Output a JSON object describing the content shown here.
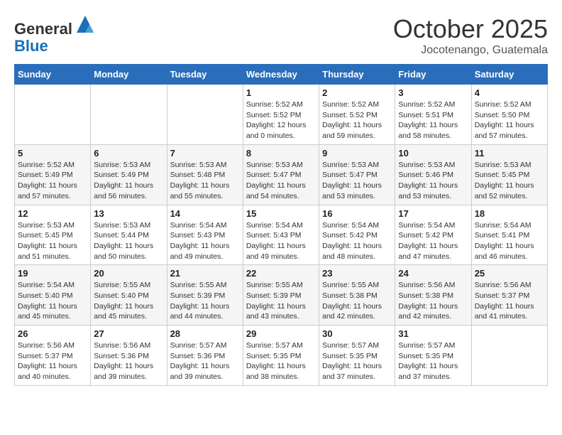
{
  "header": {
    "logo_general": "General",
    "logo_blue": "Blue",
    "month": "October 2025",
    "location": "Jocotenango, Guatemala"
  },
  "weekdays": [
    "Sunday",
    "Monday",
    "Tuesday",
    "Wednesday",
    "Thursday",
    "Friday",
    "Saturday"
  ],
  "weeks": [
    [
      {
        "day": "",
        "info": ""
      },
      {
        "day": "",
        "info": ""
      },
      {
        "day": "",
        "info": ""
      },
      {
        "day": "1",
        "info": "Sunrise: 5:52 AM\nSunset: 5:52 PM\nDaylight: 12 hours\nand 0 minutes."
      },
      {
        "day": "2",
        "info": "Sunrise: 5:52 AM\nSunset: 5:52 PM\nDaylight: 11 hours\nand 59 minutes."
      },
      {
        "day": "3",
        "info": "Sunrise: 5:52 AM\nSunset: 5:51 PM\nDaylight: 11 hours\nand 58 minutes."
      },
      {
        "day": "4",
        "info": "Sunrise: 5:52 AM\nSunset: 5:50 PM\nDaylight: 11 hours\nand 57 minutes."
      }
    ],
    [
      {
        "day": "5",
        "info": "Sunrise: 5:52 AM\nSunset: 5:49 PM\nDaylight: 11 hours\nand 57 minutes."
      },
      {
        "day": "6",
        "info": "Sunrise: 5:53 AM\nSunset: 5:49 PM\nDaylight: 11 hours\nand 56 minutes."
      },
      {
        "day": "7",
        "info": "Sunrise: 5:53 AM\nSunset: 5:48 PM\nDaylight: 11 hours\nand 55 minutes."
      },
      {
        "day": "8",
        "info": "Sunrise: 5:53 AM\nSunset: 5:47 PM\nDaylight: 11 hours\nand 54 minutes."
      },
      {
        "day": "9",
        "info": "Sunrise: 5:53 AM\nSunset: 5:47 PM\nDaylight: 11 hours\nand 53 minutes."
      },
      {
        "day": "10",
        "info": "Sunrise: 5:53 AM\nSunset: 5:46 PM\nDaylight: 11 hours\nand 53 minutes."
      },
      {
        "day": "11",
        "info": "Sunrise: 5:53 AM\nSunset: 5:45 PM\nDaylight: 11 hours\nand 52 minutes."
      }
    ],
    [
      {
        "day": "12",
        "info": "Sunrise: 5:53 AM\nSunset: 5:45 PM\nDaylight: 11 hours\nand 51 minutes."
      },
      {
        "day": "13",
        "info": "Sunrise: 5:53 AM\nSunset: 5:44 PM\nDaylight: 11 hours\nand 50 minutes."
      },
      {
        "day": "14",
        "info": "Sunrise: 5:54 AM\nSunset: 5:43 PM\nDaylight: 11 hours\nand 49 minutes."
      },
      {
        "day": "15",
        "info": "Sunrise: 5:54 AM\nSunset: 5:43 PM\nDaylight: 11 hours\nand 49 minutes."
      },
      {
        "day": "16",
        "info": "Sunrise: 5:54 AM\nSunset: 5:42 PM\nDaylight: 11 hours\nand 48 minutes."
      },
      {
        "day": "17",
        "info": "Sunrise: 5:54 AM\nSunset: 5:42 PM\nDaylight: 11 hours\nand 47 minutes."
      },
      {
        "day": "18",
        "info": "Sunrise: 5:54 AM\nSunset: 5:41 PM\nDaylight: 11 hours\nand 46 minutes."
      }
    ],
    [
      {
        "day": "19",
        "info": "Sunrise: 5:54 AM\nSunset: 5:40 PM\nDaylight: 11 hours\nand 45 minutes."
      },
      {
        "day": "20",
        "info": "Sunrise: 5:55 AM\nSunset: 5:40 PM\nDaylight: 11 hours\nand 45 minutes."
      },
      {
        "day": "21",
        "info": "Sunrise: 5:55 AM\nSunset: 5:39 PM\nDaylight: 11 hours\nand 44 minutes."
      },
      {
        "day": "22",
        "info": "Sunrise: 5:55 AM\nSunset: 5:39 PM\nDaylight: 11 hours\nand 43 minutes."
      },
      {
        "day": "23",
        "info": "Sunrise: 5:55 AM\nSunset: 5:38 PM\nDaylight: 11 hours\nand 42 minutes."
      },
      {
        "day": "24",
        "info": "Sunrise: 5:56 AM\nSunset: 5:38 PM\nDaylight: 11 hours\nand 42 minutes."
      },
      {
        "day": "25",
        "info": "Sunrise: 5:56 AM\nSunset: 5:37 PM\nDaylight: 11 hours\nand 41 minutes."
      }
    ],
    [
      {
        "day": "26",
        "info": "Sunrise: 5:56 AM\nSunset: 5:37 PM\nDaylight: 11 hours\nand 40 minutes."
      },
      {
        "day": "27",
        "info": "Sunrise: 5:56 AM\nSunset: 5:36 PM\nDaylight: 11 hours\nand 39 minutes."
      },
      {
        "day": "28",
        "info": "Sunrise: 5:57 AM\nSunset: 5:36 PM\nDaylight: 11 hours\nand 39 minutes."
      },
      {
        "day": "29",
        "info": "Sunrise: 5:57 AM\nSunset: 5:35 PM\nDaylight: 11 hours\nand 38 minutes."
      },
      {
        "day": "30",
        "info": "Sunrise: 5:57 AM\nSunset: 5:35 PM\nDaylight: 11 hours\nand 37 minutes."
      },
      {
        "day": "31",
        "info": "Sunrise: 5:57 AM\nSunset: 5:35 PM\nDaylight: 11 hours\nand 37 minutes."
      },
      {
        "day": "",
        "info": ""
      }
    ]
  ]
}
